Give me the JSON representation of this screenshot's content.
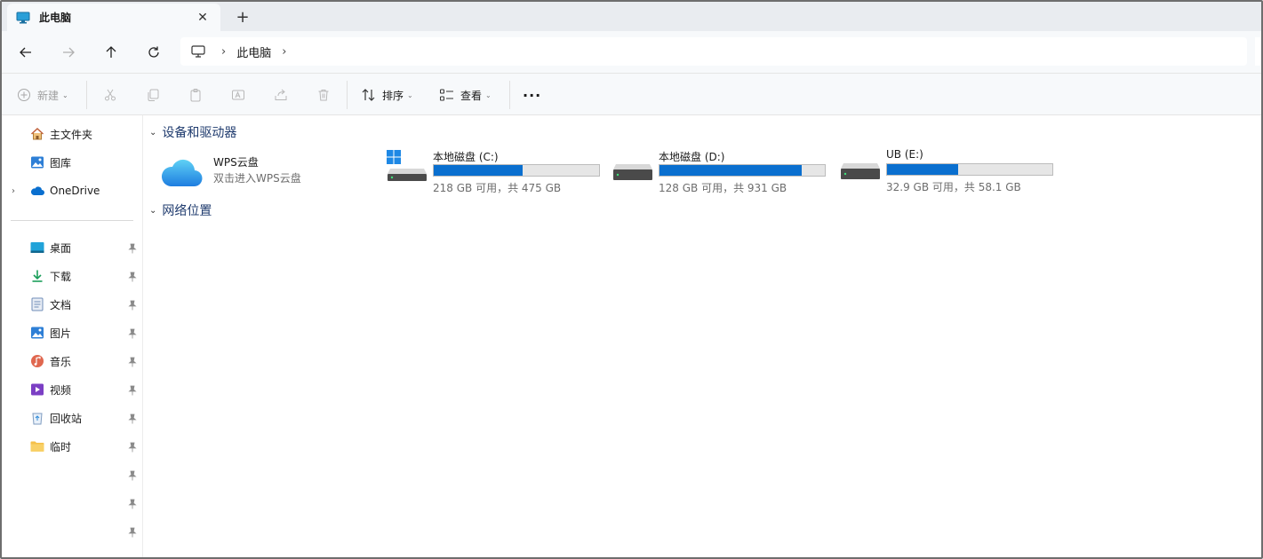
{
  "window": {
    "tab_title": "此电脑",
    "tab_close": "✕",
    "new_tab": "+"
  },
  "nav": {
    "back_icon": "arrow-left-icon",
    "forward_icon": "arrow-right-icon",
    "up_icon": "arrow-up-icon",
    "refresh_icon": "refresh-icon",
    "breadcrumb": [
      "此电脑"
    ]
  },
  "toolbar": {
    "new_label": "新建",
    "sort_label": "排序",
    "view_label": "查看",
    "more_label": "···"
  },
  "sidebar": {
    "top": [
      {
        "label": "主文件夹",
        "icon": "home-icon"
      },
      {
        "label": "图库",
        "icon": "gallery-icon"
      },
      {
        "label": "OneDrive",
        "icon": "cloud-icon"
      }
    ],
    "pinned": [
      {
        "label": "桌面",
        "icon": "desktop-icon"
      },
      {
        "label": "下载",
        "icon": "download-icon"
      },
      {
        "label": "文档",
        "icon": "document-icon"
      },
      {
        "label": "图片",
        "icon": "pictures-icon"
      },
      {
        "label": "音乐",
        "icon": "music-icon"
      },
      {
        "label": "视频",
        "icon": "video-icon"
      },
      {
        "label": "回收站",
        "icon": "recycle-bin-icon"
      },
      {
        "label": "临时",
        "icon": "folder-icon"
      }
    ]
  },
  "main": {
    "devices_header": "设备和驱动器",
    "network_header": "网络位置",
    "wps": {
      "title": "WPS云盘",
      "subtitle": "双击进入WPS云盘"
    },
    "drives": [
      {
        "name": "本地磁盘 (C:)",
        "usage": "218 GB 可用，共 475 GB",
        "used_fraction": 0.54
      },
      {
        "name": "本地磁盘 (D:)",
        "usage": "128 GB 可用，共 931 GB",
        "used_fraction": 0.86
      },
      {
        "name": "UB (E:)",
        "usage": "32.9 GB 可用，共 58.1 GB",
        "used_fraction": 0.43
      }
    ]
  },
  "colors": {
    "accent": "#0a6fcf",
    "header_text": "#1f3b6e"
  }
}
